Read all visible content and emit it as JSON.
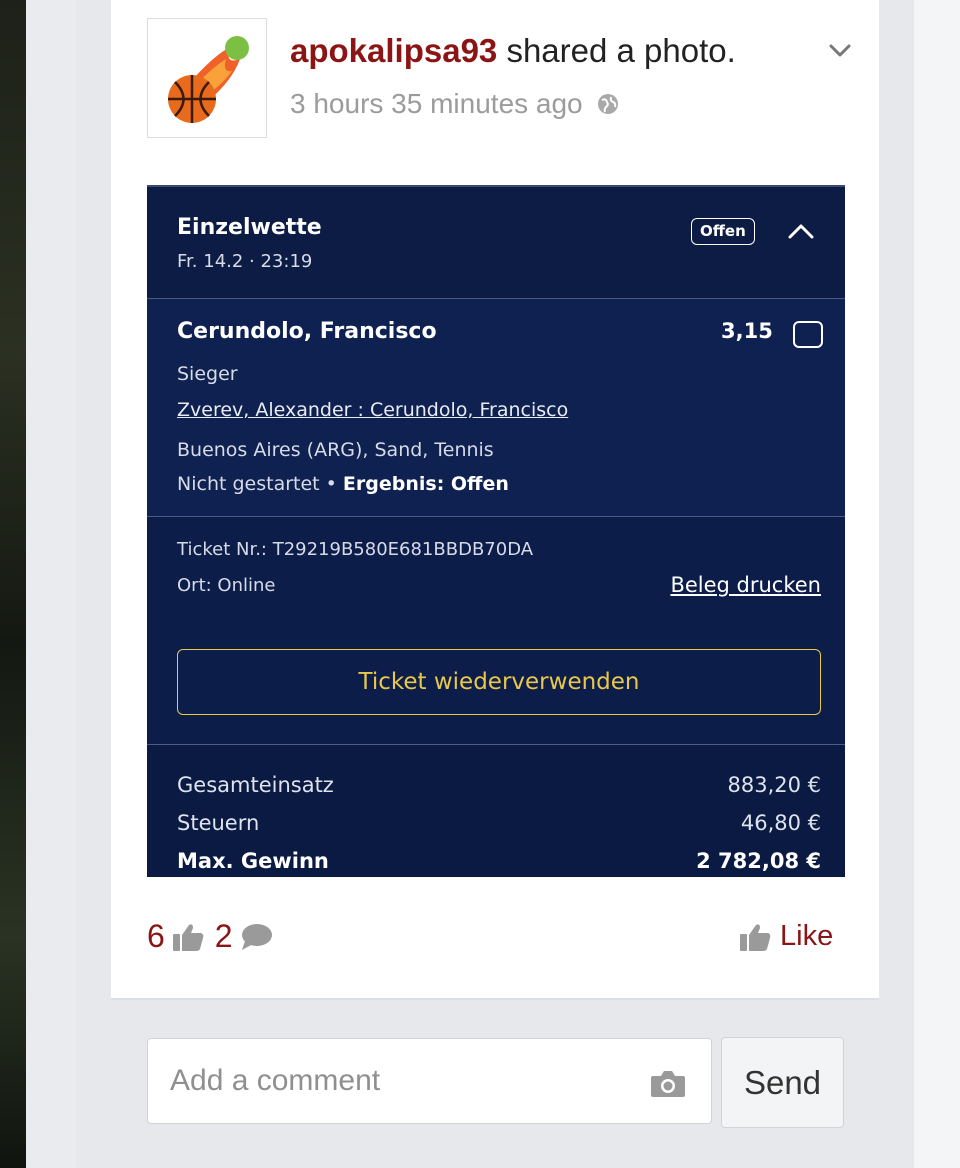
{
  "post": {
    "username": "apokalipsa93",
    "action": " shared a photo.",
    "time": "3 hours 35 minutes ago"
  },
  "ticket": {
    "bet_type": "Einzelwette",
    "date": "Fr. 14.2 · 23:19",
    "status": "Offen",
    "selection": "Cerundolo, Francisco",
    "odds": "3,15",
    "market": "Sieger",
    "event": "Zverev, Alexander : Cerundolo, Francisco",
    "venue": "Buenos Aires (ARG), Sand, Tennis",
    "state_prefix": "Nicht gestartet • ",
    "state_result": "Ergebnis: Offen",
    "ticket_nr": "Ticket Nr.: T29219B580E681BBDB70DA",
    "location": "Ort: Online",
    "print_link": "Beleg drucken",
    "reuse_button": "Ticket wiederverwenden",
    "summary": [
      {
        "label": "Gesamteinsatz",
        "value": "883,20 €"
      },
      {
        "label": "Steuern",
        "value": "46,80 €"
      },
      {
        "label": "Max. Gewinn",
        "value": "2 782,08 €"
      }
    ]
  },
  "reactions": {
    "likes_count": "6",
    "comments_count": "2",
    "like_label": "Like"
  },
  "comment": {
    "placeholder": "Add a comment",
    "send_label": "Send"
  },
  "colors": {
    "username": "#8b1515",
    "ticket_bg": "#0e1e48",
    "accent_yellow": "#e8c84a"
  },
  "icons": [
    "chevron-down-icon",
    "globe-icon",
    "chevron-up-icon",
    "thumbs-up-icon",
    "comment-bubble-icon",
    "camera-icon"
  ]
}
